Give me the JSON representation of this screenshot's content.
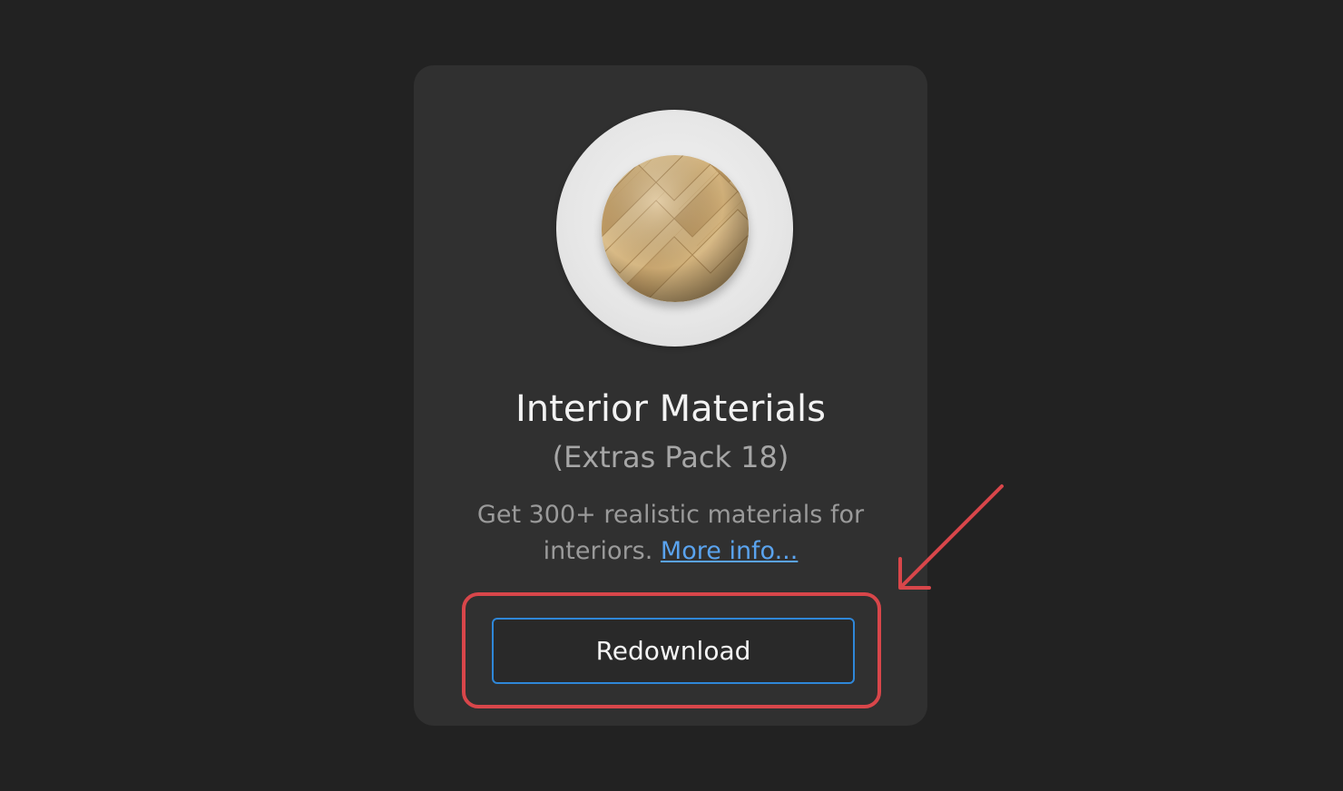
{
  "card": {
    "image_icon": "wood-herringbone-material-sphere",
    "title": "Interior Materials",
    "subtitle": "(Extras Pack 18)",
    "description": "Get 300+ realistic materials for interiors.",
    "more_link": "More info...",
    "button_label": "Redownload"
  },
  "annotation": {
    "highlight_color": "#d8464a",
    "arrow_icon": "arrow-down-left-icon"
  },
  "colors": {
    "background": "#222222",
    "card": "#303030",
    "button_border": "#2f87d8",
    "link": "#5aa3ee"
  }
}
